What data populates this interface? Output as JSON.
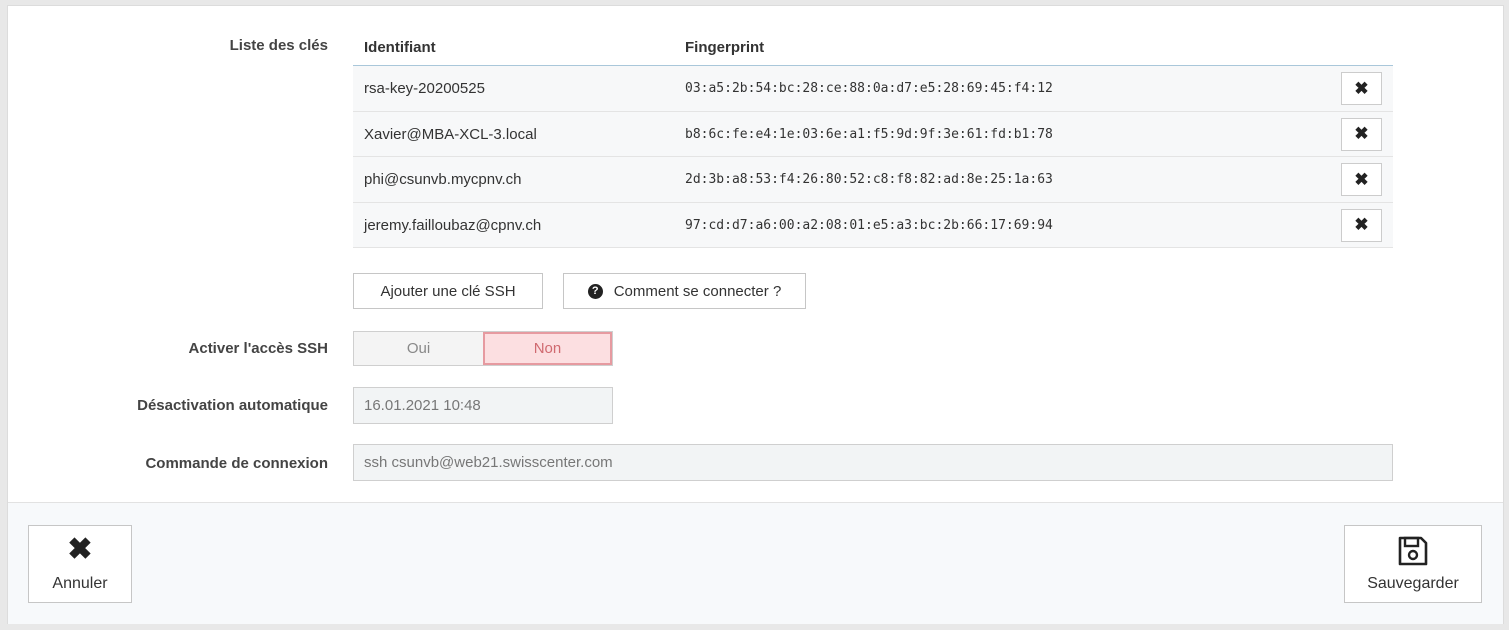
{
  "keys_section": {
    "label": "Liste des clés",
    "columns": {
      "id": "Identifiant",
      "fingerprint": "Fingerprint"
    },
    "rows": [
      {
        "id": "rsa-key-20200525",
        "fingerprint": "03:a5:2b:54:bc:28:ce:88:0a:d7:e5:28:69:45:f4:12",
        "delete_icon": "✖"
      },
      {
        "id": "Xavier@MBA-XCL-3.local",
        "fingerprint": "b8:6c:fe:e4:1e:03:6e:a1:f5:9d:9f:3e:61:fd:b1:78",
        "delete_icon": "✖"
      },
      {
        "id": "phi@csunvb.mycpnv.ch",
        "fingerprint": "2d:3b:a8:53:f4:26:80:52:c8:f8:82:ad:8e:25:1a:63",
        "delete_icon": "✖"
      },
      {
        "id": "jeremy.failloubaz@cpnv.ch",
        "fingerprint": "97:cd:d7:a6:00:a2:08:01:e5:a3:bc:2b:66:17:69:94",
        "delete_icon": "✖"
      }
    ]
  },
  "actions": {
    "add_key": "Ajouter une clé SSH",
    "how_to_connect": "Comment se connecter ?",
    "help_icon": "?"
  },
  "ssh_access": {
    "label": "Activer l'accès SSH",
    "yes": "Oui",
    "no": "Non",
    "selected": "Non"
  },
  "auto_disable": {
    "label": "Désactivation automatique",
    "value": "16.01.2021 10:48"
  },
  "connect_command": {
    "label": "Commande de connexion",
    "value": "ssh csunvb@web21.swisscenter.com"
  },
  "footer": {
    "cancel": "Annuler",
    "cancel_icon": "✖",
    "save": "Sauvegarder",
    "save_icon": "floppy-disk-icon"
  }
}
